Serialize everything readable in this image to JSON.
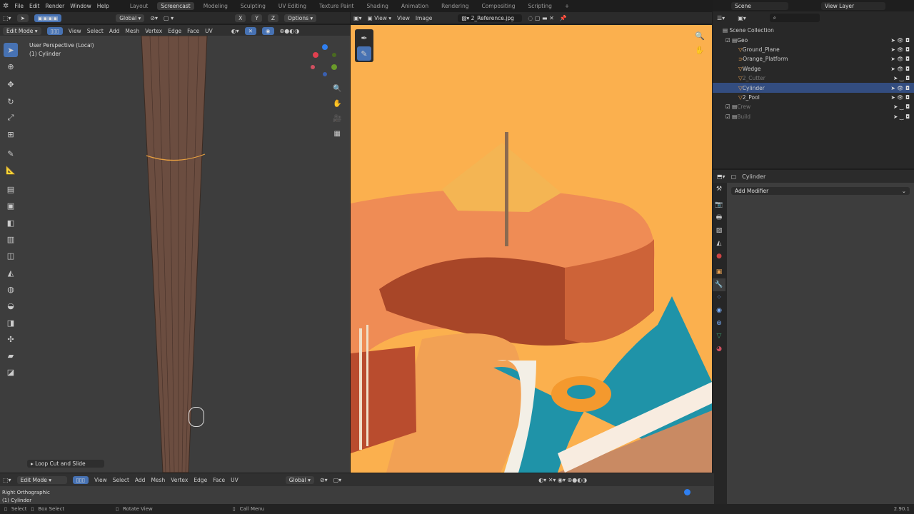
{
  "topbar": {
    "menus": [
      "File",
      "Edit",
      "Render",
      "Window",
      "Help"
    ],
    "workspaces": [
      "Layout",
      "Screencast",
      "Modeling",
      "Sculpting",
      "UV Editing",
      "Texture Paint",
      "Shading",
      "Animation",
      "Rendering",
      "Compositing",
      "Scripting"
    ],
    "active_workspace": "Screencast",
    "add_tab": "+"
  },
  "viewport": {
    "transform_orientation": "Global",
    "options_label": "Options",
    "axes": [
      "X",
      "Y",
      "Z"
    ],
    "mode": "Edit Mode",
    "menus": [
      "View",
      "Select",
      "Add",
      "Mesh",
      "Vertex",
      "Edge",
      "Face",
      "UV"
    ],
    "overlay_title": "User Perspective (Local)",
    "overlay_object": "(1) Cylinder",
    "last_op": "Loop Cut and Slide",
    "gizmo_axes": [
      "X",
      "Y",
      "Z"
    ]
  },
  "image_editor": {
    "menus": [
      "View",
      "View",
      "Image"
    ],
    "image_name": "2_Reference.jpg",
    "colors": {
      "background": "#fbb04e",
      "platform": "#e9864f",
      "wall": "#c95a34",
      "pool": "#1f93a8",
      "ring": "#f4992e"
    }
  },
  "outliner": {
    "scene": "Scene",
    "view_layer": "View Layer",
    "root": "Scene Collection",
    "items": [
      {
        "name": "Geo",
        "type": "collection",
        "depth": 0
      },
      {
        "name": "Ground_Plane",
        "type": "mesh",
        "depth": 1
      },
      {
        "name": "Orange_Platform",
        "type": "curve",
        "depth": 1
      },
      {
        "name": "Wedge",
        "type": "mesh",
        "depth": 1
      },
      {
        "name": "2_Cutter",
        "type": "mesh",
        "depth": 1,
        "hidden": true
      },
      {
        "name": "Cylinder",
        "type": "mesh",
        "depth": 1,
        "selected": true
      },
      {
        "name": "2_Pool",
        "type": "mesh",
        "depth": 1
      },
      {
        "name": "Crew",
        "type": "collection",
        "depth": 0,
        "hidden": true
      },
      {
        "name": "Build",
        "type": "collection",
        "depth": 0,
        "hidden": true
      }
    ]
  },
  "properties": {
    "object_name": "Cylinder",
    "add_modifier": "Add Modifier"
  },
  "bottom_view": {
    "mode": "Edit Mode",
    "menus": [
      "View",
      "Select",
      "Add",
      "Mesh",
      "Vertex",
      "Edge",
      "Face",
      "UV"
    ],
    "orientation": "Global",
    "overlay_title": "Right Orthographic",
    "overlay_object": "(1) Cylinder"
  },
  "status": {
    "select": "Select",
    "box_select": "Box Select",
    "rotate": "Rotate View",
    "call_menu": "Call Menu",
    "version": "2.90.1"
  }
}
